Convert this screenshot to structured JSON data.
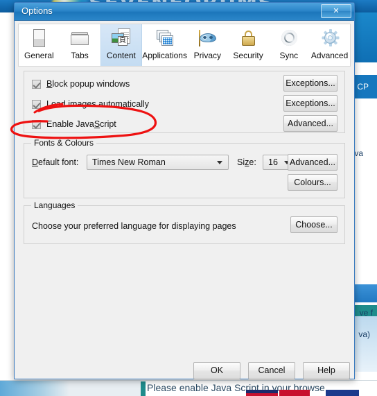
{
  "background": {
    "logo_text": "SEVENFORUMS",
    "fragment_cp": "CP",
    "fragment_va": "va",
    "fragment_ve_f": "ve f",
    "fragment_java": "va)",
    "bottom_notice": "Please enable Java Script in your browse"
  },
  "window": {
    "title": "Options",
    "close_label": "✕"
  },
  "toolbar": {
    "items": [
      {
        "label": "General",
        "icon": "page-icon",
        "selected": false
      },
      {
        "label": "Tabs",
        "icon": "folder-icon",
        "selected": false
      },
      {
        "label": "Content",
        "icon": "content-page-icon",
        "selected": true
      },
      {
        "label": "Applications",
        "icon": "windows-icon",
        "selected": false
      },
      {
        "label": "Privacy",
        "icon": "mask-icon",
        "selected": false
      },
      {
        "label": "Security",
        "icon": "padlock-icon",
        "selected": false
      },
      {
        "label": "Sync",
        "icon": "sync-arrows-icon",
        "selected": false
      },
      {
        "label": "Advanced",
        "icon": "gear-icon",
        "selected": false
      }
    ]
  },
  "content": {
    "checkboxes": [
      {
        "label": "Block popup windows",
        "checked": true,
        "button": "Exceptions..."
      },
      {
        "label": "Load images automatically",
        "checked": true,
        "button": "Exceptions..."
      },
      {
        "label": "Enable JavaScript",
        "checked": true,
        "button": "Advanced..."
      }
    ],
    "fonts_group": {
      "legend": "Fonts & Colours",
      "font_label": "Default font:",
      "font_value": "Times New Roman",
      "size_label": "Size:",
      "size_value": "16",
      "advanced_button": "Advanced...",
      "colours_button": "Colours..."
    },
    "languages_group": {
      "legend": "Languages",
      "description": "Choose your preferred language for displaying pages",
      "choose_button": "Choose..."
    }
  },
  "footer": {
    "ok": "OK",
    "cancel": "Cancel",
    "help": "Help"
  },
  "annotation": {
    "color": "#ee1111",
    "shape": "hand-drawn-oval-around-enable-javascript"
  }
}
